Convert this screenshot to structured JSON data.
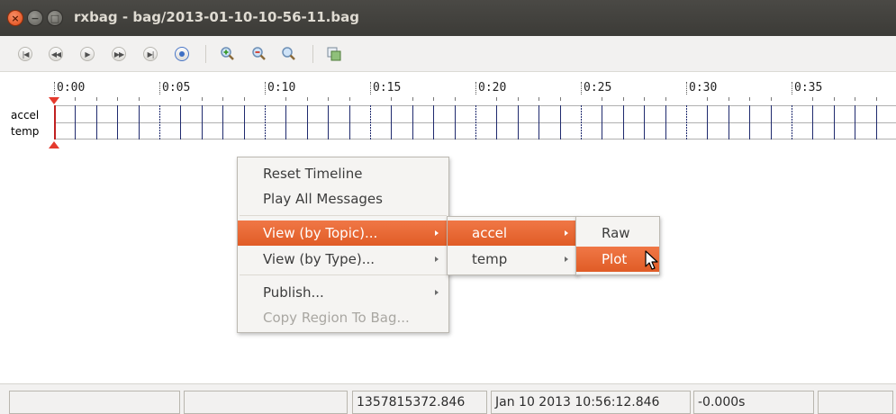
{
  "window": {
    "title": "rxbag - bag/2013-01-10-10-56-11.bag",
    "buttons": {
      "close": "×",
      "minimize": "−",
      "maximize": "□"
    }
  },
  "toolbar": {
    "buttons": [
      {
        "name": "begin-button",
        "glyph": "|◀"
      },
      {
        "name": "rewind-button",
        "glyph": "◀◀"
      },
      {
        "name": "play-button",
        "glyph": "▶"
      },
      {
        "name": "fast-forward-button",
        "glyph": "▶▶"
      },
      {
        "name": "end-button",
        "glyph": "▶|"
      },
      {
        "name": "stop-button",
        "glyph": ""
      }
    ],
    "icons": [
      "zoom-in-icon",
      "zoom-out-icon",
      "zoom-reset-icon",
      "thumbnails-icon"
    ]
  },
  "timeline": {
    "tick_labels": [
      "0:00",
      "0:05",
      "0:10",
      "0:15",
      "0:20",
      "0:25",
      "0:30",
      "0:35"
    ],
    "topics": [
      "accel",
      "temp"
    ],
    "colors": {
      "grid_lines": "#1f2a6e",
      "marker": "#e53a2d"
    }
  },
  "context_menu": {
    "items": [
      {
        "label": "Reset Timeline",
        "submenu": false,
        "enabled": true
      },
      {
        "label": "Play All Messages",
        "submenu": false,
        "enabled": true
      },
      {
        "label": "View (by Topic)...",
        "submenu": true,
        "enabled": true,
        "highlighted": true
      },
      {
        "label": "View (by Type)...",
        "submenu": true,
        "enabled": true
      },
      {
        "label": "Publish...",
        "submenu": true,
        "enabled": true
      },
      {
        "label": "Copy Region To Bag...",
        "submenu": false,
        "enabled": false
      }
    ],
    "topic_submenu": [
      {
        "label": "accel",
        "highlighted": true
      },
      {
        "label": "temp",
        "highlighted": false
      }
    ],
    "view_submenu": [
      {
        "label": "Raw",
        "highlighted": false
      },
      {
        "label": "Plot",
        "highlighted": true
      }
    ],
    "highlight_color": "#e8632f"
  },
  "statusbar": {
    "cells": [
      "",
      "",
      "1357815372.846",
      "Jan 10 2013 10:56:12.846",
      "-0.000s",
      ""
    ]
  }
}
